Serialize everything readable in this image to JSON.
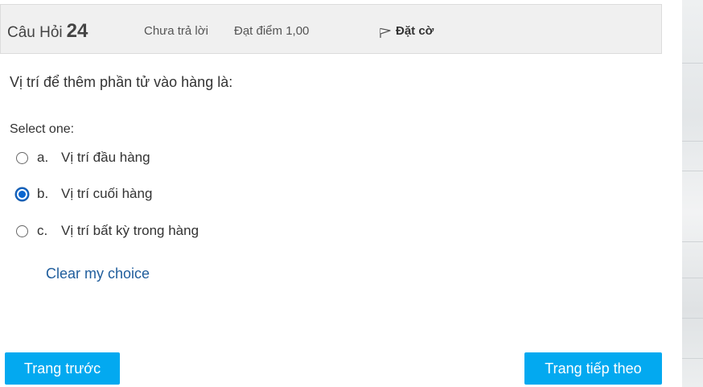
{
  "header": {
    "question_label": "Câu Hỏi",
    "question_number": "24",
    "status": "Chưa trả lời",
    "grade": "Đạt điểm 1,00",
    "flag_label": "Đặt cờ",
    "flag_icon": "flag-outline-icon"
  },
  "question": {
    "text": "Vị trí để thêm phần tử vào hàng là:",
    "prompt": "Select one:",
    "options": [
      {
        "letter": "a.",
        "text": "Vị trí đầu hàng",
        "selected": false
      },
      {
        "letter": "b.",
        "text": "Vị trí cuối hàng",
        "selected": true
      },
      {
        "letter": "c.",
        "text": "Vị trí bất kỳ trong hàng",
        "selected": false
      }
    ],
    "clear_label": "Clear my choice"
  },
  "navigation": {
    "prev_label": "Trang trước",
    "next_label": "Trang tiếp theo"
  },
  "colors": {
    "header_bg": "#f0f0f0",
    "button_bg": "#03a9f0",
    "link": "#1f5d9c",
    "radio_selected": "#0a66d0"
  }
}
